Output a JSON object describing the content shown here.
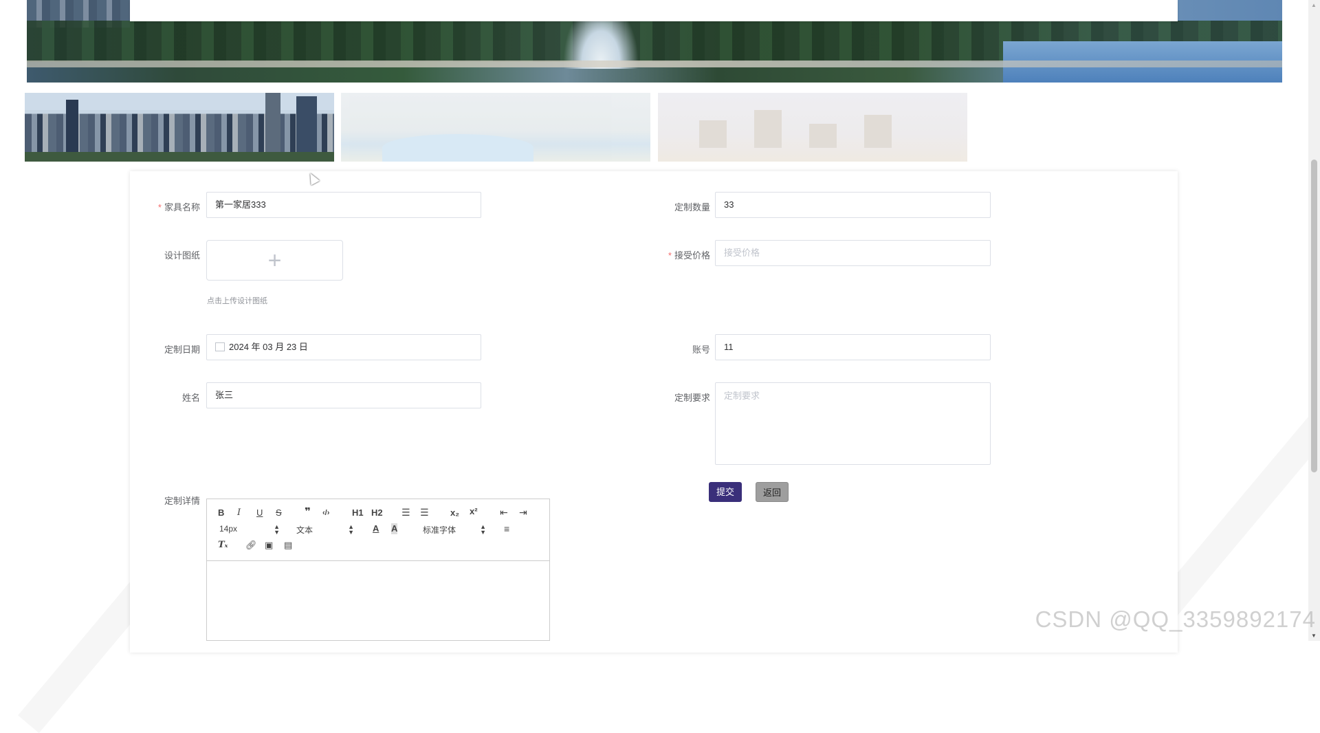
{
  "form": {
    "furniture_name": {
      "label": "家具名称",
      "required": true,
      "value": "第一家居333"
    },
    "custom_quantity": {
      "label": "定制数量",
      "required": false,
      "value": "33"
    },
    "design_drawing": {
      "label": "设计图纸",
      "required": false,
      "upload_tip": "点击上传设计图纸"
    },
    "accepted_price": {
      "label": "接受价格",
      "required": true,
      "placeholder": "接受价格"
    },
    "custom_date": {
      "label": "定制日期",
      "value": "2024 年 03 月 23 日"
    },
    "account": {
      "label": "账号",
      "value": "11"
    },
    "name": {
      "label": "姓名",
      "value": "张三"
    },
    "custom_requirements": {
      "label": "定制要求",
      "placeholder": "定制要求"
    },
    "custom_details": {
      "label": "定制详情"
    }
  },
  "buttons": {
    "submit": "提交",
    "back": "返回"
  },
  "editor": {
    "font_size": "14px",
    "text_type": "文本",
    "font_family": "标准字体",
    "heading1": "H1",
    "heading2": "H2",
    "bold": "B",
    "italic": "I",
    "underline": "U",
    "strike": "S"
  },
  "watermark": "CSDN @QQ_3359892174",
  "colors": {
    "submit_bg": "#3a2f7a",
    "back_bg": "#9e9e9e",
    "required_star": "#f56c6c"
  }
}
